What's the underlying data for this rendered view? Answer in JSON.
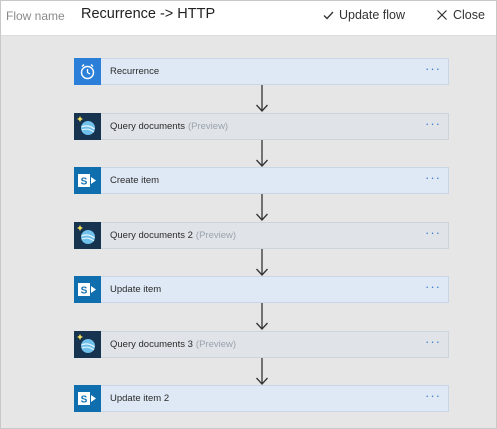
{
  "header": {
    "flow_name_label": "Flow name",
    "flow_title": "Recurrence -> HTTP",
    "update_flow_label": "Update flow",
    "close_label": "Close"
  },
  "steps": [
    {
      "label": "Recurrence",
      "preview": "",
      "icon": "clock-icon",
      "more": "···"
    },
    {
      "label": "Query documents",
      "preview": "(Preview)",
      "icon": "cosmos-db-icon",
      "more": "···"
    },
    {
      "label": "Create item",
      "preview": "",
      "icon": "sharepoint-icon",
      "more": "···"
    },
    {
      "label": "Query documents 2",
      "preview": "(Preview)",
      "icon": "cosmos-db-icon",
      "more": "···"
    },
    {
      "label": "Update item",
      "preview": "",
      "icon": "sharepoint-icon",
      "more": "···"
    },
    {
      "label": "Query documents 3",
      "preview": "(Preview)",
      "icon": "cosmos-db-icon",
      "more": "···"
    },
    {
      "label": "Update item 2",
      "preview": "",
      "icon": "sharepoint-icon",
      "more": "···"
    }
  ],
  "colors": {
    "accent": "#2b7fd8",
    "sharepoint": "#0f6fae",
    "cosmos": "#16334f",
    "step_bg": "#dfe9f5"
  }
}
